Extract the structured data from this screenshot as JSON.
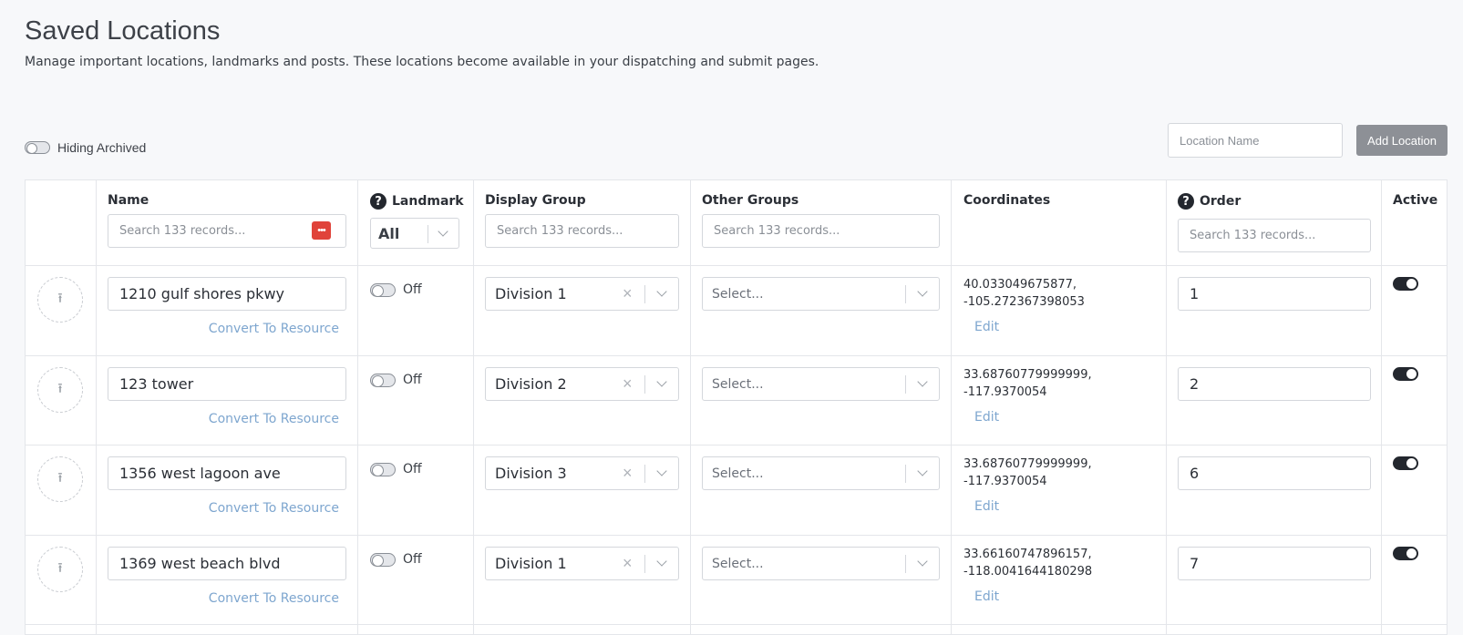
{
  "page": {
    "title": "Saved Locations",
    "subtitle": "Manage important locations, landmarks and posts. These locations become available in your dispatching and submit pages."
  },
  "toolbar": {
    "archived_label": "Hiding Archived",
    "location_placeholder": "Location Name",
    "add_label": "Add Location"
  },
  "table": {
    "headers": {
      "name": "Name",
      "landmark": "Landmark",
      "display_group": "Display Group",
      "other_groups": "Other Groups",
      "coordinates": "Coordinates",
      "order": "Order",
      "active": "Active"
    },
    "help_glyph": "?",
    "search_placeholder": "Search 133 records...",
    "landmark_filter": "All",
    "rows": [
      {
        "name": "1210 gulf shores pkwy",
        "convert": "Convert To Resource",
        "landmark": "Off",
        "display_group": "Division 1",
        "other_groups_placeholder": "Select...",
        "coord_lat": "40.033049675877,",
        "coord_lng": "-105.272367398053",
        "edit": "Edit",
        "order": "1",
        "active": true
      },
      {
        "name": "123 tower",
        "convert": "Convert To Resource",
        "landmark": "Off",
        "display_group": "Division 2",
        "other_groups_placeholder": "Select...",
        "coord_lat": "33.68760779999999,",
        "coord_lng": "-117.9370054",
        "edit": "Edit",
        "order": "2",
        "active": true
      },
      {
        "name": "1356 west lagoon ave",
        "convert": "Convert To Resource",
        "landmark": "Off",
        "display_group": "Division 3",
        "other_groups_placeholder": "Select...",
        "coord_lat": "33.68760779999999,",
        "coord_lng": "-117.9370054",
        "edit": "Edit",
        "order": "6",
        "active": true
      },
      {
        "name": "1369 west beach blvd",
        "convert": "Convert To Resource",
        "landmark": "Off",
        "display_group": "Division 1",
        "other_groups_placeholder": "Select...",
        "coord_lat": "33.66160747896157,",
        "coord_lng": "-118.0041644180298",
        "edit": "Edit",
        "order": "7",
        "active": true
      }
    ]
  },
  "icons": {
    "upload": "upload-arrow-icon",
    "dots": "more-options-icon",
    "chevron": "chevron-down-icon",
    "clear": "clear-x-icon",
    "help": "help-circle-icon"
  },
  "colors": {
    "accent_dark": "#23272e",
    "link": "#7ea6cf",
    "button_gray": "#8d9096",
    "dots_red": "#e0433a"
  }
}
